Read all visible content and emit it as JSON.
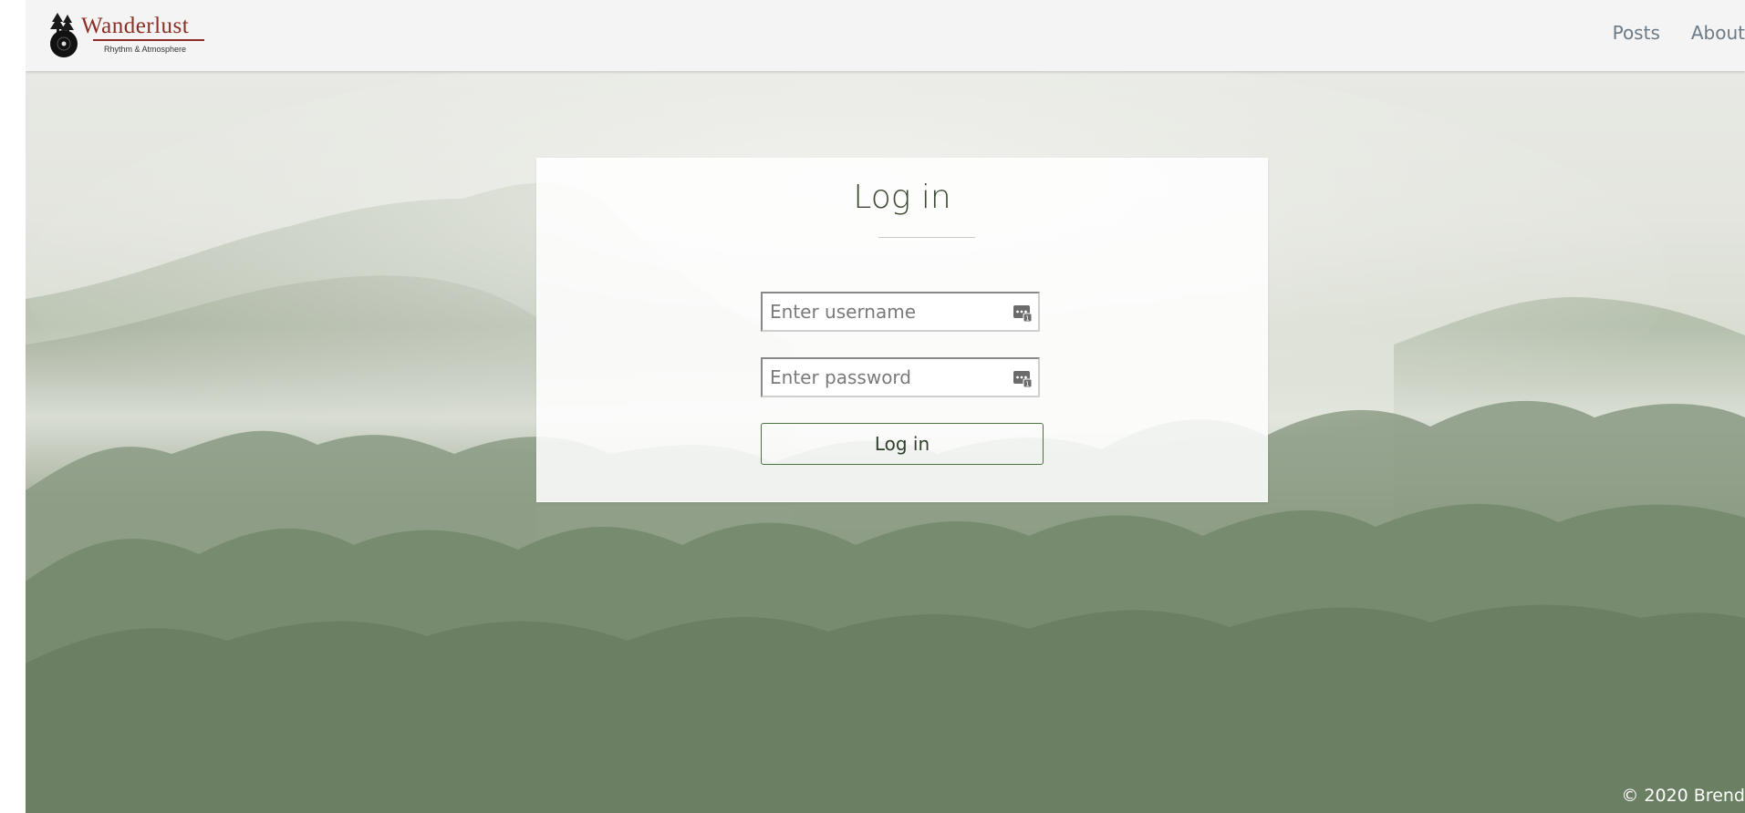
{
  "brand": {
    "name": "Wanderlust",
    "tagline": "Rhythm & Atmosphere",
    "accent_color": "#8b2d24"
  },
  "nav": {
    "items": [
      {
        "label": "Posts"
      },
      {
        "label": "About"
      }
    ]
  },
  "login": {
    "title": "Log in",
    "username_placeholder": "Enter username",
    "password_placeholder": "Enter password",
    "submit_label": "Log in",
    "field_icon": "password-manager-icon",
    "button_border_color": "#4a7340"
  },
  "footer": {
    "text": "© 2020 Brend"
  }
}
